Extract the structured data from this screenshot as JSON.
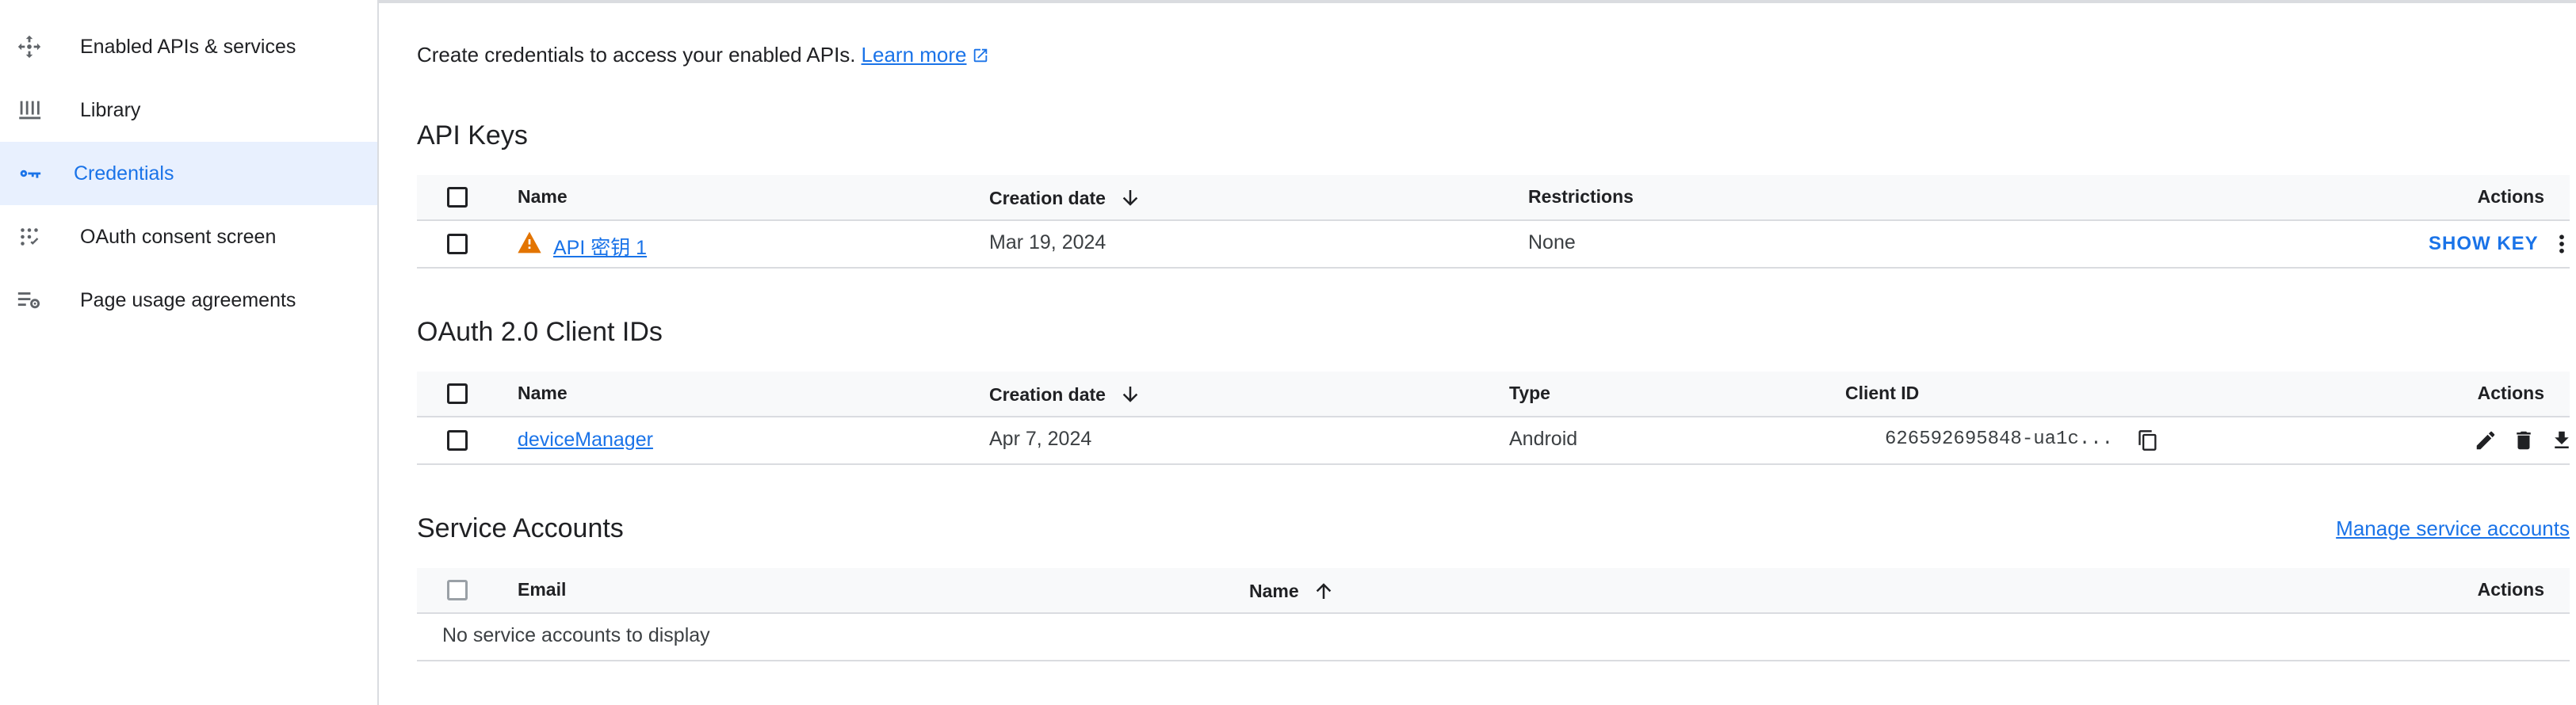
{
  "sidebar": {
    "items": [
      {
        "label": "Enabled APIs & services",
        "icon": "api-services-icon"
      },
      {
        "label": "Library",
        "icon": "library-icon"
      },
      {
        "label": "Credentials",
        "icon": "key-icon",
        "active": true
      },
      {
        "label": "OAuth consent screen",
        "icon": "oauth-consent-icon"
      },
      {
        "label": "Page usage agreements",
        "icon": "settings-list-icon"
      }
    ]
  },
  "intro": {
    "text": "Create credentials to access your enabled APIs.",
    "learn_more": "Learn more"
  },
  "api_keys": {
    "title": "API Keys",
    "columns": {
      "name": "Name",
      "creation_date": "Creation date",
      "restrictions": "Restrictions",
      "actions": "Actions"
    },
    "rows": [
      {
        "name": "API 密钥 1",
        "creation_date": "Mar 19, 2024",
        "restrictions": "None",
        "action": "SHOW KEY",
        "warning": true
      }
    ]
  },
  "oauth": {
    "title": "OAuth 2.0 Client IDs",
    "columns": {
      "name": "Name",
      "creation_date": "Creation date",
      "type": "Type",
      "client_id": "Client ID",
      "actions": "Actions"
    },
    "rows": [
      {
        "name": "deviceManager",
        "creation_date": "Apr 7, 2024",
        "type": "Android",
        "client_id": "626592695848-ua1c..."
      }
    ]
  },
  "service_accounts": {
    "title": "Service Accounts",
    "manage_link": "Manage service accounts",
    "columns": {
      "email": "Email",
      "name": "Name",
      "actions": "Actions"
    },
    "empty_text": "No service accounts to display"
  },
  "colors": {
    "accent": "#1a73e8",
    "active_bg": "#e8f0fe",
    "warning": "#e37400",
    "header_bg": "#f8f9fa",
    "border": "#dadce0"
  }
}
